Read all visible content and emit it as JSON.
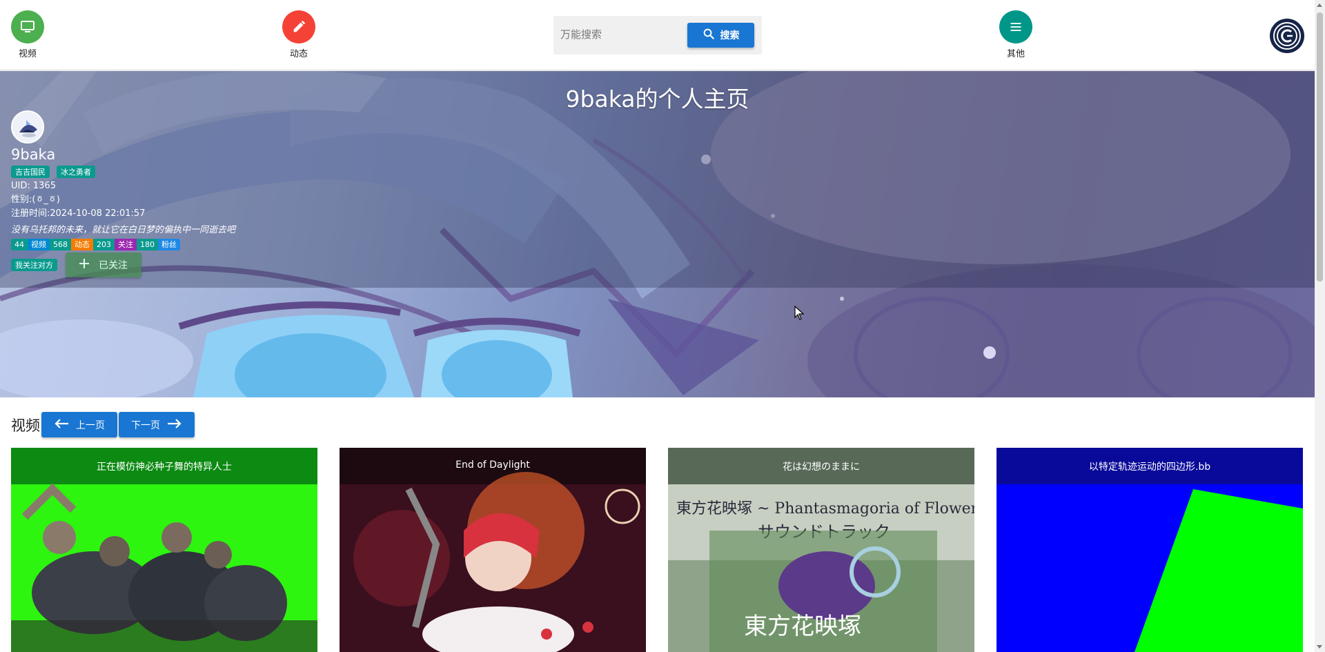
{
  "nav": {
    "video": {
      "label": "视频",
      "color": "#4caf50",
      "icon": "tv-icon"
    },
    "dynamic": {
      "label": "动态",
      "color": "#f44336",
      "icon": "pencil-icon"
    },
    "other": {
      "label": "其他",
      "color": "#009688",
      "icon": "menu-icon"
    },
    "search": {
      "placeholder": "万能搜索",
      "button_label": "搜索"
    }
  },
  "profile": {
    "page_title": "9baka的个人主页",
    "username": "9baka",
    "badges": [
      "吉吉国民",
      "冰之勇者"
    ],
    "uid_label": "UID:",
    "uid": "1365",
    "gender_label": "性别:",
    "gender": "(ㆆ_ㆆ)",
    "register_label": "注册时间:",
    "register_time": "2024-10-08 22:01:57",
    "motto": "没有乌托邦的未来，就让它在白日梦的偏执中一同逝去吧",
    "stats": [
      {
        "value": "44",
        "label": "视频",
        "color": "#0288d1"
      },
      {
        "value": "568",
        "label": "动态",
        "color": "#f57c00"
      },
      {
        "value": "203",
        "label": "关注",
        "color": "#9c27b0"
      },
      {
        "value": "180",
        "label": "粉丝",
        "color": "#1e88e5"
      }
    ],
    "follow_status": "我关注对方",
    "follow_button": "已关注"
  },
  "videos": {
    "section_title": "视频",
    "prev_label": "上一页",
    "next_label": "下一页",
    "items": [
      {
        "title": "正在模仿神必种子舞的特异人士"
      },
      {
        "title": "End of Daylight"
      },
      {
        "title": "花は幻想のままに"
      },
      {
        "title": "以特定轨迹运动的四边形.bb"
      }
    ]
  }
}
